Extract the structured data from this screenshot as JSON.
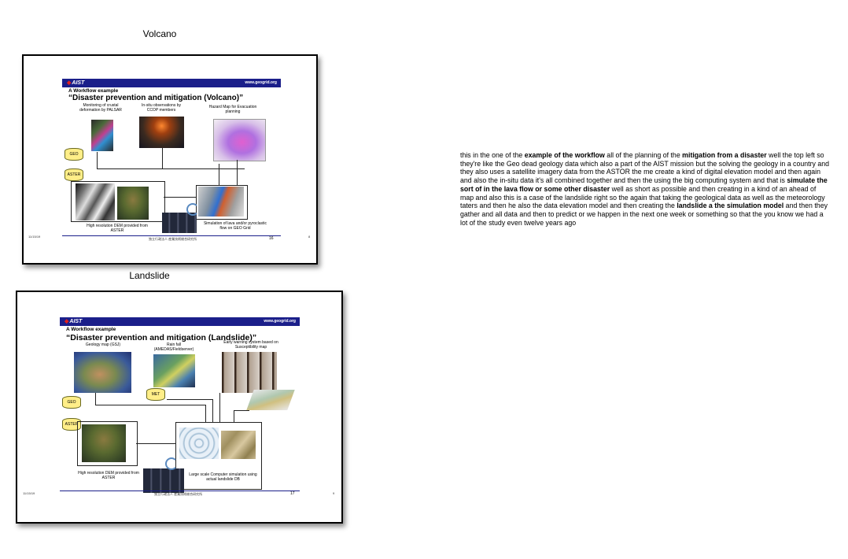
{
  "slides": [
    {
      "caption": "Volcano",
      "header_logo": "AIST",
      "header_url": "www.geogrid.org",
      "subtitle": "A Workflow example",
      "title": "“Disaster prevention and mitigation (Volcano)”",
      "labels": {
        "monitoring": "Monitoring of crustal deformation by PALSAR",
        "insitu": "In-situ observations by CCOP members",
        "hazard": "Hazard Map for Evacuation planning",
        "dem": "High resolution DEM provided from ASTER",
        "simulation": "Simulation of lava and/or pyroclastic flow on GEO Grid"
      },
      "cylinders": [
        "GEO",
        "ASTER"
      ],
      "date": "11/15/19",
      "footer": "独立行政法人 産業技術総合研究所",
      "page_number": "16",
      "side_number": "8"
    },
    {
      "caption": "Landslide",
      "header_logo": "AIST",
      "header_url": "www.geogrid.org",
      "subtitle": "A Workflow example",
      "title": "“Disaster prevention and mitigation (Landslide)”",
      "labels": {
        "geology": "Geology map (GSJ)",
        "rainfall": "Rain fall (AMEDAS/Fieldserver)",
        "warning": "Early warning system based on Susceptibility map",
        "dem": "High resolution DEM provided from ASTER",
        "computer": "Large scale Computer simulation using actual landslide DB"
      },
      "cylinders": [
        "GEO",
        "ASTER",
        "MET"
      ],
      "date": "11/15/19",
      "footer": "独立行政法人 産業技術総合研究所",
      "page_number": "17",
      "side_number": "9"
    }
  ],
  "notes": {
    "t1": "this in the one of the ",
    "b1": "example of the workflow",
    "t2": " all of the planning of the ",
    "b2": "mitigation from a disaster",
    "t3": " well the top left so they're like the Geo dead geology data which also a part of the AIST mission but the solving the geology in a country and they also uses a satellite imagery data from the ASTOR the me create a kind of digital elevation model and then again and also the in-situ data it's all combined together and then the using the big computing system and that is ",
    "b3": "simulate the sort of in the lava flow or some other disaster",
    "t4": " well as short as possible and then creating in a kind of an ahead of map and also this is a case of the landslide right so the again that taking the geological data as well as the meteorology taters and then he also the data elevation model and then creating the ",
    "b4": "landslide a the simulation model",
    "t5": " and then they gather and all data and then to predict or we happen in the next one week or something so that the you know we had a lot of the study even twelve years ago"
  }
}
